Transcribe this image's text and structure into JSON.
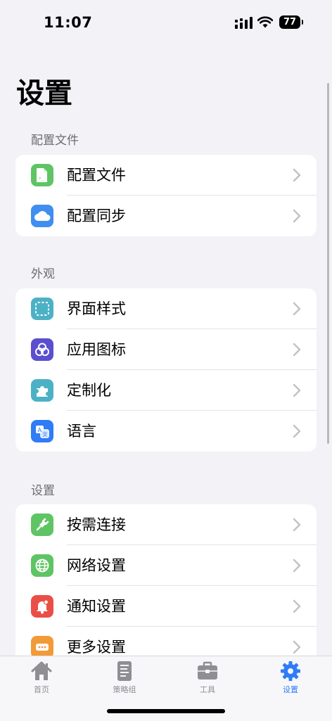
{
  "status": {
    "time": "11:07",
    "battery": "77"
  },
  "page_title": "设置",
  "sections": [
    {
      "header": "配置文件",
      "items": [
        {
          "label": "配置文件",
          "icon": "document-icon",
          "color": "#5fc464"
        },
        {
          "label": "配置同步",
          "icon": "cloud-icon",
          "color": "#3f8ef0"
        }
      ]
    },
    {
      "header": "外观",
      "items": [
        {
          "label": "界面样式",
          "icon": "dashed-square-icon",
          "color": "#4db1c6"
        },
        {
          "label": "应用图标",
          "icon": "interlocking-rings-icon",
          "color": "#5a4fcf"
        },
        {
          "label": "定制化",
          "icon": "puzzle-icon",
          "color": "#4db1c6"
        },
        {
          "label": "语言",
          "icon": "translate-icon",
          "color": "#2f7cf6"
        }
      ]
    },
    {
      "header": "设置",
      "items": [
        {
          "label": "按需连接",
          "icon": "plug-icon",
          "color": "#5fc464"
        },
        {
          "label": "网络设置",
          "icon": "globe-icon",
          "color": "#5fc464"
        },
        {
          "label": "通知设置",
          "icon": "bell-icon",
          "color": "#ea4f47"
        },
        {
          "label": "更多设置",
          "icon": "more-icon",
          "color": "#f29a38"
        }
      ]
    }
  ],
  "tabs": [
    {
      "label": "首页",
      "icon": "home-icon"
    },
    {
      "label": "策略组",
      "icon": "strategy-doc-icon"
    },
    {
      "label": "工具",
      "icon": "toolbox-icon"
    },
    {
      "label": "设置",
      "icon": "gear-icon",
      "active": true
    }
  ],
  "colors": {
    "accent": "#2f7cf6",
    "background": "#f2f2f7"
  }
}
